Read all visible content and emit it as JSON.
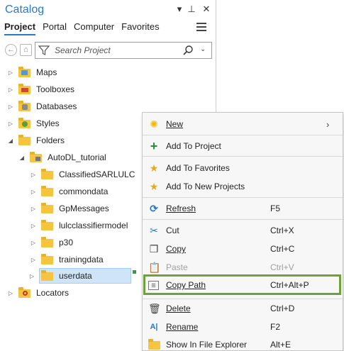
{
  "pane": {
    "title": "Catalog",
    "tabs": [
      "Project",
      "Portal",
      "Computer",
      "Favorites"
    ],
    "search_placeholder": "Search Project"
  },
  "tree": {
    "items": [
      {
        "label": "Maps",
        "icon": "maps-folder-icon"
      },
      {
        "label": "Toolboxes",
        "icon": "toolbox-folder-icon"
      },
      {
        "label": "Databases",
        "icon": "database-folder-icon"
      },
      {
        "label": "Styles",
        "icon": "styles-folder-icon"
      },
      {
        "label": "Folders",
        "icon": "folder-icon"
      },
      {
        "label": "AutoDL_tutorial",
        "icon": "home-folder-icon"
      },
      {
        "label": "ClassifiedSARLULC",
        "icon": "folder-icon"
      },
      {
        "label": "commondata",
        "icon": "folder-icon"
      },
      {
        "label": "GpMessages",
        "icon": "folder-icon"
      },
      {
        "label": "lulcclassifiermodel",
        "icon": "folder-icon"
      },
      {
        "label": "p30",
        "icon": "folder-icon"
      },
      {
        "label": "trainingdata",
        "icon": "folder-icon"
      },
      {
        "label": "userdata",
        "icon": "folder-icon"
      },
      {
        "label": "Locators",
        "icon": "locators-folder-icon"
      }
    ]
  },
  "context_menu": {
    "items": [
      {
        "label": "New",
        "shortcut": "",
        "icon": "new-sparkle-icon"
      },
      {
        "label": "Add To Project",
        "shortcut": "",
        "icon": "plus-icon"
      },
      {
        "label": "Add To Favorites",
        "shortcut": "",
        "icon": "star-icon"
      },
      {
        "label": "Add To New Projects",
        "shortcut": "",
        "icon": "star-sparkle-icon"
      },
      {
        "label": "Refresh",
        "shortcut": "F5",
        "icon": "refresh-icon"
      },
      {
        "label": "Cut",
        "shortcut": "Ctrl+X",
        "icon": "scissors-icon"
      },
      {
        "label": "Copy",
        "shortcut": "Ctrl+C",
        "icon": "copy-icon"
      },
      {
        "label": "Paste",
        "shortcut": "Ctrl+V",
        "icon": "paste-icon"
      },
      {
        "label": "Copy Path",
        "shortcut": "Ctrl+Alt+P",
        "icon": "copy-path-icon"
      },
      {
        "label": "Delete",
        "shortcut": "Ctrl+D",
        "icon": "delete-icon"
      },
      {
        "label": "Rename",
        "shortcut": "F2",
        "icon": "rename-icon"
      },
      {
        "label": "Show In File Explorer",
        "shortcut": "Alt+E",
        "icon": "file-explorer-icon"
      }
    ]
  },
  "colors": {
    "accent": "#2a79c5",
    "highlight": "#6ea13a",
    "folder": "#f3c543"
  }
}
